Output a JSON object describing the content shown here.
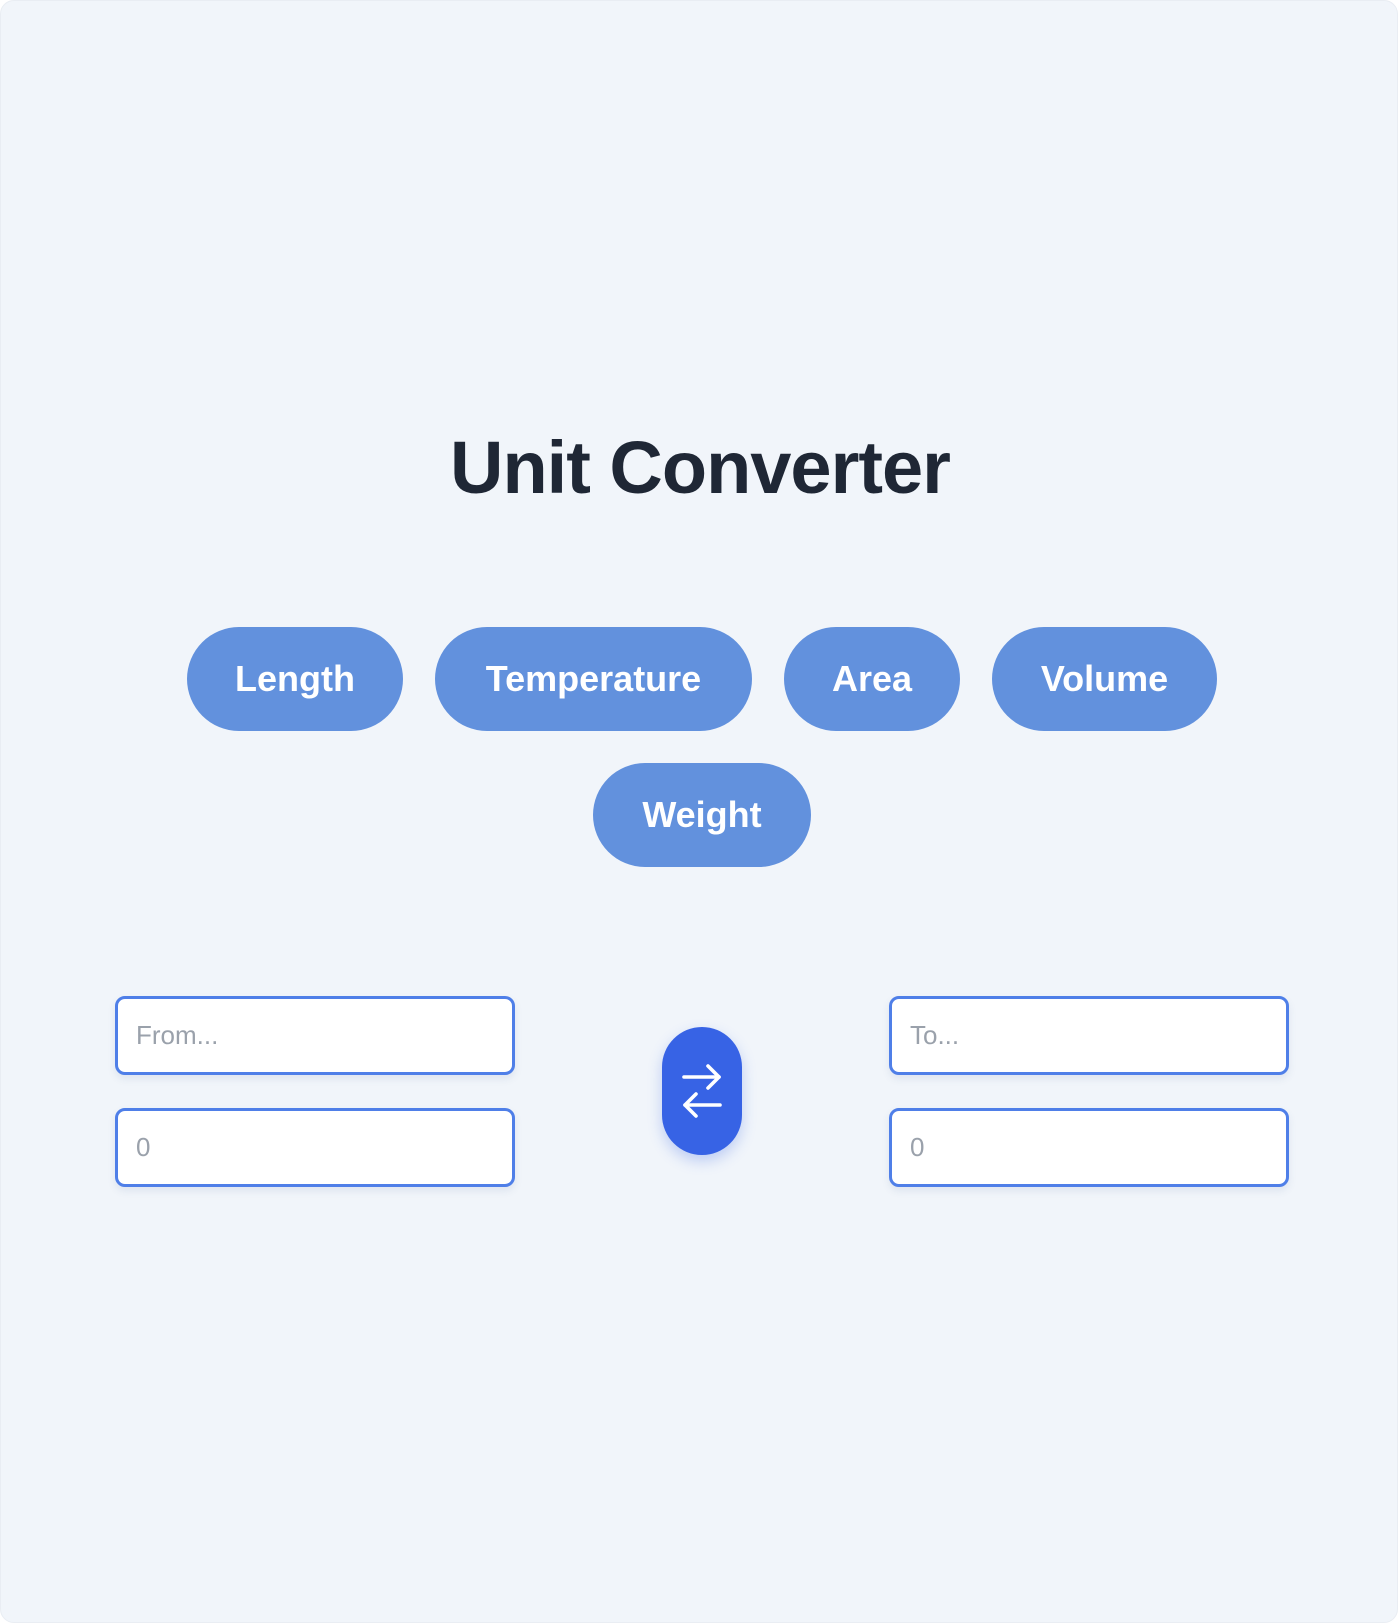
{
  "app": {
    "title": "Unit Converter"
  },
  "categories": [
    {
      "label": "Length"
    },
    {
      "label": "Temperature"
    },
    {
      "label": "Area"
    },
    {
      "label": "Volume"
    },
    {
      "label": "Weight"
    }
  ],
  "converter": {
    "from_unit": {
      "value": "",
      "placeholder": "From..."
    },
    "from_amount": {
      "value": "",
      "placeholder": "0"
    },
    "to_unit": {
      "value": "",
      "placeholder": "To..."
    },
    "to_amount": {
      "value": "",
      "placeholder": "0"
    },
    "swap_icon": "swap-arrows-icon"
  },
  "colors": {
    "background": "#f1f5fa",
    "title": "#1f2735",
    "pill": "#6291dd",
    "accent": "#3763e5",
    "field_border": "#4f7fe8",
    "placeholder": "#9aa1ab"
  }
}
